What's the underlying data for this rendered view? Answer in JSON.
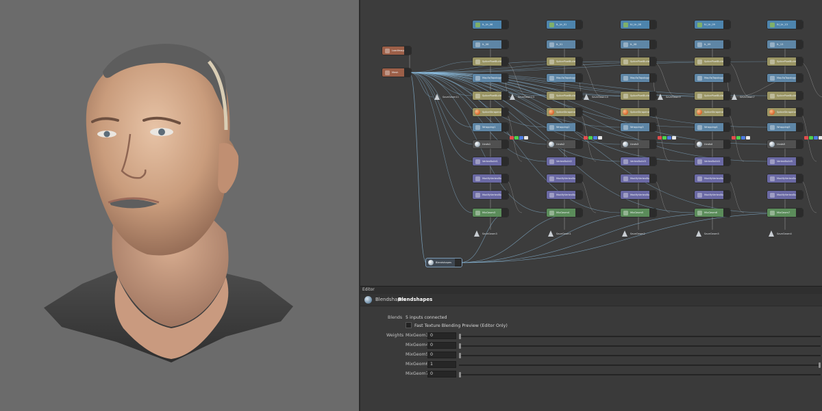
{
  "viewport": {
    "background": "#6b6b6b"
  },
  "graph": {
    "top_nodes": [
      {
        "label": "IL_Ur_06"
      },
      {
        "label": "IL_Ur_01"
      },
      {
        "label": "IU_Ur_08"
      },
      {
        "label": "IU_Ur_09"
      },
      {
        "label": "IU_Ur_13"
      }
    ],
    "columns": [
      {
        "labels": [
          "IL_06",
          "SplicePixelBuild3",
          "Map5qTopology1",
          "SplicePixelBuild8",
          "SpliceShrapened1",
          "Wrapping1",
          "Uvuls1",
          "VertexBuild1",
          "ModifyVertexBuild4",
          "ModifyVertexBuild3",
          "MixGeom3",
          "SaveGeom3"
        ]
      },
      {
        "labels": [
          "IL_01",
          "SplicePixelBuild4",
          "Map5qTopology2",
          "SplicePixelBuild9",
          "SpliceShrapened2",
          "Wrapping2",
          "Uvuls2",
          "VertexBuild2",
          "ModifyVertexBuild5",
          "ModifyVertexBuild6",
          "MixGeom4",
          "SaveGeom1"
        ]
      },
      {
        "labels": [
          "IL_08",
          "SplicePixelBuild5",
          "Map5qTopology3",
          "SplicePixelBuild10",
          "SpliceShrapened3",
          "Wrapping3",
          "Uvuls3",
          "VertexBuild3",
          "ModifyVertexBuild7",
          "ModifyVertexBuild8",
          "MixGeom5",
          "SaveGeom2"
        ]
      },
      {
        "labels": [
          "IL_09",
          "SplicePixelBuild6",
          "Map5qTopology4",
          "SplicePixelBuild11",
          "SpliceShrapened4",
          "Wrapping4",
          "Uvuls4",
          "VertexBuild4",
          "ModifyVertexBuild9",
          "ModifyVertexBuild10",
          "MixGeom6",
          "SaveGeom5"
        ]
      },
      {
        "labels": [
          "IL_13",
          "SplicePixelBuild7",
          "Map5qTopology5",
          "SplicePixelBuild12",
          "SpliceShrapened5",
          "Wrapping5",
          "Uvuls5",
          "VertexBuild5",
          "ModifyVertexBuild11",
          "ModifyVertexBuild12",
          "MixGeom7",
          "SaveGeom4"
        ]
      }
    ],
    "save_mid": [
      "SaveGeom11",
      "SaveGeom13",
      "SaveGeom10",
      "SaveGeom9",
      "SaveGeom7"
    ],
    "left_nodes": [
      {
        "label": "LoadImage"
      },
      {
        "label": "Mesh"
      }
    ],
    "blend_node": {
      "label": "Blendshapes"
    }
  },
  "editor": {
    "panel_title": "Editor",
    "node_type": "Blendshapes",
    "node_name": "Blendshapes",
    "blends_label": "Blends",
    "blends_value": "5 inputs connected",
    "fast_texture_label": "Fast Texture Blending Preview (Editor Only)",
    "fast_texture_checked": false,
    "weights_label": "Weights",
    "weights": [
      {
        "name": "MixGeom3",
        "value": "0",
        "level": 0
      },
      {
        "name": "MixGeom4",
        "value": "0",
        "level": 0
      },
      {
        "name": "MixGeom5",
        "value": "0",
        "level": 0
      },
      {
        "name": "MixGeom6",
        "value": "1",
        "level": 1
      },
      {
        "name": "MixGeom7",
        "value": "0",
        "level": 0
      }
    ]
  }
}
